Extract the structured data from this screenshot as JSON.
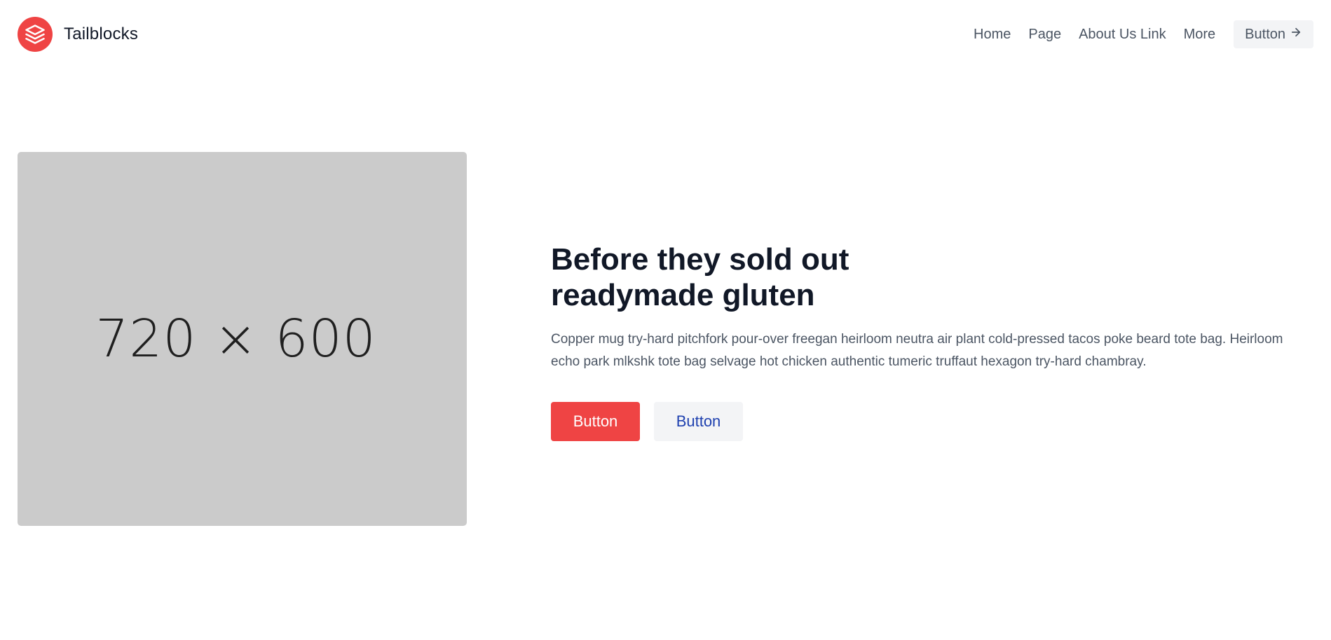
{
  "header": {
    "brand_name": "Tailblocks",
    "logo_icon": "stacked-layers-icon",
    "nav": [
      {
        "label": "Home"
      },
      {
        "label": "Page"
      },
      {
        "label": "About Us Link"
      },
      {
        "label": "More"
      }
    ],
    "cta_label": "Button",
    "cta_icon": "arrow-right-icon"
  },
  "hero": {
    "image_placeholder": "720 × 600",
    "title_line1": "Before they sold out",
    "title_line2": "readymade gluten",
    "description": "Copper mug try-hard pitchfork pour-over freegan heirloom neutra air plant cold-pressed tacos poke beard tote bag. Heirloom echo park mlkshk tote bag selvage hot chicken authentic tumeric truffaut hexagon try-hard chambray.",
    "primary_button": "Button",
    "secondary_button": "Button"
  },
  "colors": {
    "accent": "#ef4444",
    "heading": "#111827",
    "text": "#4b5563",
    "secondary_button_bg": "#f3f4f6",
    "secondary_button_text": "#1e40af",
    "image_placeholder_bg": "#cbcbcb"
  }
}
